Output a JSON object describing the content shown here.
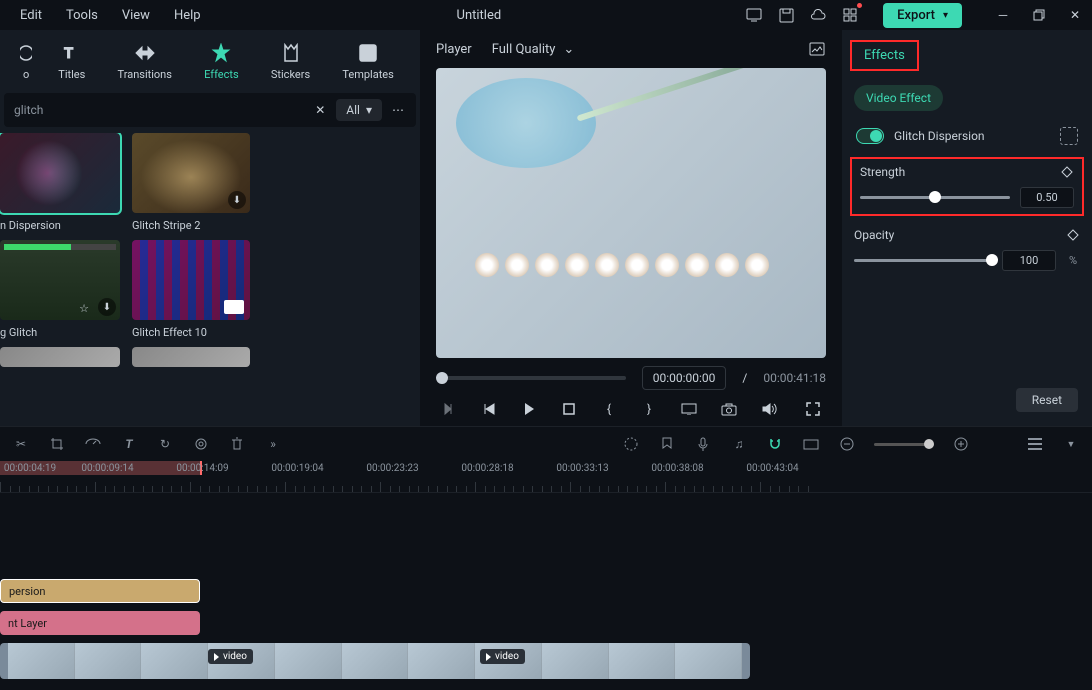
{
  "menu": {
    "edit": "Edit",
    "tools": "Tools",
    "view": "View",
    "help": "Help"
  },
  "title": "Untitled",
  "export_label": "Export",
  "tabs": {
    "titles": "Titles",
    "transitions": "Transitions",
    "effects": "Effects",
    "stickers": "Stickers",
    "templates": "Templates"
  },
  "search": {
    "query": "glitch",
    "filter_all": "All"
  },
  "thumbs": {
    "t1": "n Dispersion",
    "t2": "Glitch Stripe 2",
    "t3": "g Glitch",
    "t4": "Glitch Effect 10"
  },
  "player": {
    "label": "Player",
    "quality": "Full Quality",
    "current": "00:00:00:00",
    "sep": "/",
    "total": "00:00:41:18"
  },
  "ruler": [
    "00:00:04:19",
    "00:00:09:14",
    "00:00:14:09",
    "00:00:19:04",
    "00:00:23:23",
    "00:00:28:18",
    "00:00:33:13",
    "00:00:38:08",
    "00:00:43:04"
  ],
  "tracks": {
    "clip1": "persion",
    "clip2": "nt Layer",
    "vidlabel": "video"
  },
  "right": {
    "tab": "Effects",
    "pill": "Video Effect",
    "effect_name": "Glitch Dispersion",
    "strength_label": "Strength",
    "strength_val": "0.50",
    "opacity_label": "Opacity",
    "opacity_val": "100",
    "pct": "%",
    "reset": "Reset"
  }
}
